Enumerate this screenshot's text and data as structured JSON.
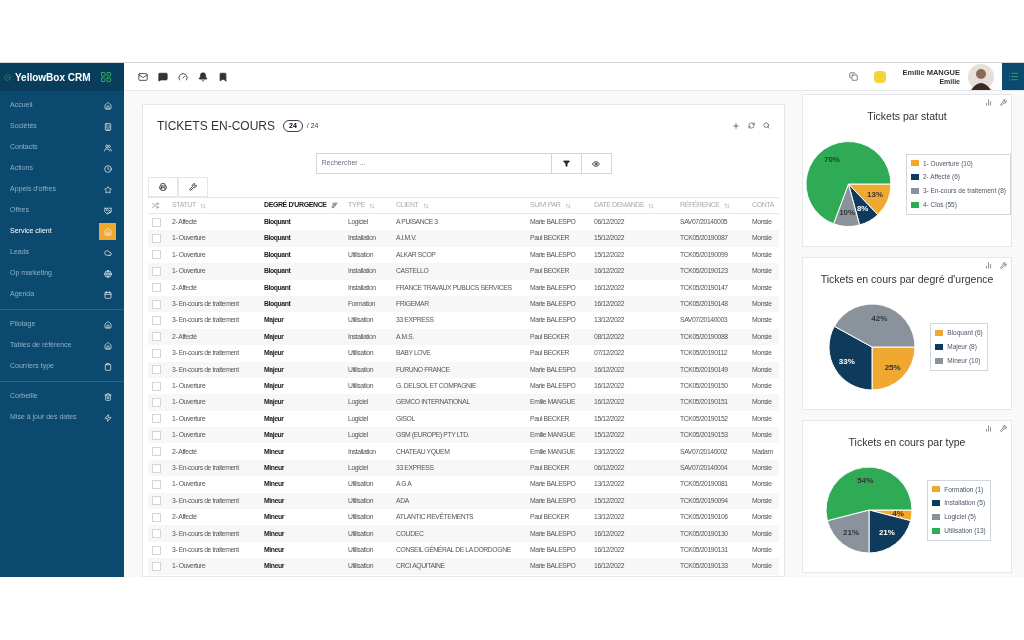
{
  "app": {
    "name": "YellowBox CRM"
  },
  "sidebar": {
    "groups": [
      [
        {
          "label": "Accueil",
          "selected": false
        },
        {
          "label": "Sociétés",
          "selected": false
        },
        {
          "label": "Contacts",
          "selected": false
        },
        {
          "label": "Actions",
          "selected": false
        },
        {
          "label": "Appels d'offres",
          "selected": false
        },
        {
          "label": "Offres",
          "selected": false
        },
        {
          "label": "Service client",
          "selected": true
        },
        {
          "label": "Leads",
          "selected": false
        },
        {
          "label": "Op marketing",
          "selected": false
        },
        {
          "label": "Agenda",
          "selected": false
        }
      ],
      [
        {
          "label": "Pilotage",
          "selected": false
        },
        {
          "label": "Tables de référence",
          "selected": false
        },
        {
          "label": "Courriers type",
          "selected": false
        }
      ],
      [
        {
          "label": "Corbeille",
          "selected": false
        },
        {
          "label": "Mise à jour des dates",
          "selected": false
        }
      ]
    ]
  },
  "user": {
    "name": "Emilie MANGUE",
    "first_name": "Emilie"
  },
  "tickets": {
    "title": "TICKETS EN-COURS",
    "count": "24",
    "total": "/ 24",
    "search": {
      "placeholder": "Rechercher ..."
    },
    "columns": [
      {
        "label": "STATUT",
        "sorted": false
      },
      {
        "label": "DEGRÉ D'URGENCE",
        "sorted": true
      },
      {
        "label": "TYPE",
        "sorted": false
      },
      {
        "label": "CLIENT",
        "sorted": false
      },
      {
        "label": "SUIVI PAR",
        "sorted": false
      },
      {
        "label": "DATE DEMANDE",
        "sorted": false
      },
      {
        "label": "RÉFÉRENCE",
        "sorted": false
      },
      {
        "label": "CONTA",
        "sorted": false
      }
    ],
    "rows": [
      {
        "checked": false,
        "cells": [
          "2- Affecté",
          "Bloquant",
          "Logiciel",
          "A PUISANCE 3",
          "Marie BALESPO",
          "06/12/2022",
          "SAV07/20140005",
          "Monsie"
        ]
      },
      {
        "checked": false,
        "cells": [
          "1- Ouverture",
          "Bloquant",
          "Installation",
          "A.I.M.V.",
          "Paul BECKER",
          "15/12/2022",
          "TCK05/20190087",
          "Monsie"
        ]
      },
      {
        "checked": false,
        "cells": [
          "1- Ouverture",
          "Bloquant",
          "Utilisation",
          "ALKAR SCOP",
          "Marie BALESPO",
          "15/12/2022",
          "TCK05/20190099",
          "Monsie"
        ]
      },
      {
        "checked": false,
        "cells": [
          "1- Ouverture",
          "Bloquant",
          "Installation",
          "CASTELLO",
          "Paul BECKER",
          "16/12/2022",
          "TCK05/20190123",
          "Monsie"
        ]
      },
      {
        "checked": false,
        "cells": [
          "2- Affecté",
          "Bloquant",
          "Installation",
          "FRANCE TRAVAUX PUBLICS SERVICES",
          "Marie BALESPO",
          "16/12/2022",
          "TCK05/20190147",
          "Monsie"
        ]
      },
      {
        "checked": false,
        "cells": [
          "3- En-cours de traitement",
          "Bloquant",
          "Formation",
          "FRIGEMAR",
          "Marie BALESPO",
          "16/12/2022",
          "TCK05/20190148",
          "Monsie"
        ]
      },
      {
        "checked": false,
        "cells": [
          "3- En-cours de traitement",
          "Majeur",
          "Utilisation",
          "33 EXPRESS",
          "Marie BALESPO",
          "13/12/2022",
          "SAV07/20140003",
          "Monsie"
        ]
      },
      {
        "checked": false,
        "cells": [
          "2- Affecté",
          "Majeur",
          "Installation",
          "A.M.S.",
          "Paul BECKER",
          "08/12/2022",
          "TCK05/20190088",
          "Monsie"
        ]
      },
      {
        "checked": false,
        "cells": [
          "3- En-cours de traitement",
          "Majeur",
          "Utilisation",
          "BABY LOVE",
          "Paul BECKER",
          "07/12/2022",
          "TCK05/20190112",
          "Monsie"
        ]
      },
      {
        "checked": false,
        "cells": [
          "3- En-cours de traitement",
          "Majeur",
          "Utilisation",
          "FURUNO FRANCE",
          "Marie BALESPO",
          "16/12/2022",
          "TCK05/20190149",
          "Monsie"
        ]
      },
      {
        "checked": false,
        "cells": [
          "1- Ouverture",
          "Majeur",
          "Utilisation",
          "G. DELSOL ET COMPAGNIE",
          "Marie BALESPO",
          "16/12/2022",
          "TCK05/20190150",
          "Monsie"
        ]
      },
      {
        "checked": false,
        "cells": [
          "1- Ouverture",
          "Majeur",
          "Logiciel",
          "GEMCO INTERNATIONAL",
          "Emilie MANGUE",
          "16/12/2022",
          "TCK05/20190151",
          "Monsie"
        ]
      },
      {
        "checked": false,
        "cells": [
          "1- Ouverture",
          "Majeur",
          "Logiciel",
          "GISOL",
          "Paul BECKER",
          "15/12/2022",
          "TCK05/20190152",
          "Monsie"
        ]
      },
      {
        "checked": false,
        "cells": [
          "1- Ouverture",
          "Majeur",
          "Logiciel",
          "GSM (EUROPE) PTY LTD.",
          "Emilie MANGUE",
          "15/12/2022",
          "TCK05/20190153",
          "Monsie"
        ]
      },
      {
        "checked": false,
        "cells": [
          "2- Affecté",
          "Mineur",
          "Installation",
          "CHATEAU YQUEM",
          "Emilie MANGUE",
          "13/12/2022",
          "SAV07/20140002",
          "Madam"
        ]
      },
      {
        "checked": false,
        "cells": [
          "3- En-cours de traitement",
          "Mineur",
          "Logiciel",
          "33 EXPRESS",
          "Paul BECKER",
          "06/12/2022",
          "SAV07/20140004",
          "Monsie"
        ]
      },
      {
        "checked": false,
        "cells": [
          "1- Ouverture",
          "Mineur",
          "Utilisation",
          "A G A",
          "Marie BALESPO",
          "13/12/2022",
          "TCK05/20190081",
          "Monsie"
        ]
      },
      {
        "checked": false,
        "cells": [
          "3- En-cours de traitement",
          "Mineur",
          "Utilisation",
          "ADA",
          "Marie BALESPO",
          "15/12/2022",
          "TCK05/20190094",
          "Monsie"
        ]
      },
      {
        "checked": false,
        "cells": [
          "2- Affecté",
          "Mineur",
          "Utilisation",
          "ATLANTIC REVÊTEMENTS",
          "Paul BECKER",
          "13/12/2022",
          "TCK05/20190106",
          "Monsie"
        ]
      },
      {
        "checked": false,
        "cells": [
          "3- En-cours de traitement",
          "Mineur",
          "Utilisation",
          "COLIDEC",
          "Marie BALESPO",
          "16/12/2022",
          "TCK05/20190130",
          "Monsie"
        ]
      },
      {
        "checked": false,
        "cells": [
          "3- En-cours de traitement",
          "Mineur",
          "Utilisation",
          "CONSEIL GÉNÉRAL DE LA DORDOGNE",
          "Marie BALESPO",
          "16/12/2022",
          "TCK05/20190131",
          "Monsie"
        ]
      },
      {
        "checked": false,
        "cells": [
          "1- Ouverture",
          "Mineur",
          "Utilisation",
          "CRCI AQUITAINE",
          "Marie BALESPO",
          "16/12/2022",
          "TCK05/20190133",
          "Monsie"
        ]
      }
    ]
  },
  "charts": [
    {
      "title": "Tickets par statut",
      "chart_data": {
        "type": "pie",
        "categories": [
          "1- Ouverture (10)",
          "2- Affecté (6)",
          "3- En-cours de traitement (8)",
          "4- Clos (55)"
        ],
        "values": [
          13,
          8,
          10,
          70
        ],
        "legend": "right",
        "colors": [
          "#f0a830",
          "#0e3a5c",
          "#8a939c",
          "#2faa55"
        ],
        "value_labels": [
          "13%",
          "8%",
          "10%",
          "70%"
        ]
      }
    },
    {
      "title": "Tickets en cours par degré d'urgence",
      "chart_data": {
        "type": "pie",
        "categories": [
          "Bloquant (6)",
          "Majeur (8)",
          "Mineur (10)"
        ],
        "values": [
          25,
          33,
          42
        ],
        "legend": "right",
        "colors": [
          "#f0a830",
          "#0e3a5c",
          "#8a939c"
        ],
        "value_labels": [
          "25%",
          "33%",
          "42%"
        ]
      }
    },
    {
      "title": "Tickets en cours par type",
      "chart_data": {
        "type": "pie",
        "categories": [
          "Formation (1)",
          "Installation (5)",
          "Logiciel (5)",
          "Utilisation (13)"
        ],
        "values": [
          4,
          21,
          21,
          54
        ],
        "legend": "right",
        "colors": [
          "#f0a830",
          "#0e3a5c",
          "#8a939c",
          "#2faa55"
        ],
        "value_labels": [
          "4%",
          "21%",
          "21%",
          "54%"
        ]
      }
    }
  ]
}
